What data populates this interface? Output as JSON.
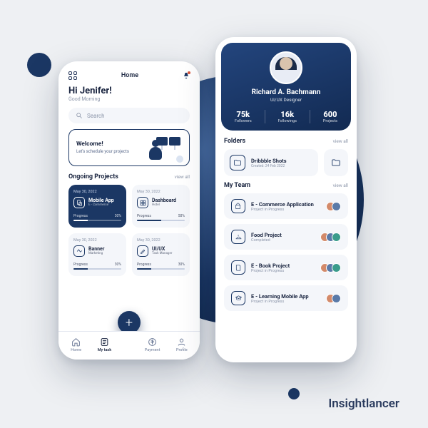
{
  "brand": "Insightlancer",
  "phone1": {
    "topbar_title": "Home",
    "greeting": "Hi Jenifer!",
    "sub_greeting": "Good Morning",
    "search_placeholder": "Search",
    "welcome": {
      "title": "Welcome!",
      "subtitle": "Let's schedule your projects"
    },
    "ongoing_header": "Ongoing Projects",
    "view_all": "view all",
    "projects": [
      {
        "date": "May 30, 2022",
        "name": "Mobile App",
        "category": "E - Commerce",
        "progress_label": "Progress",
        "percent": "30%",
        "pct": 30,
        "highlight": true
      },
      {
        "date": "May 30, 2022",
        "name": "Dashboard",
        "category": "Hotel",
        "progress_label": "Progress",
        "percent": "50%",
        "pct": 50,
        "highlight": false
      },
      {
        "date": "May 30, 2022",
        "name": "Banner",
        "category": "Marketing",
        "progress_label": "Progress",
        "percent": "30%",
        "pct": 30,
        "highlight": false
      },
      {
        "date": "May 30, 2022",
        "name": "UI/UX",
        "category": "Task Manager",
        "progress_label": "Progress",
        "percent": "30%",
        "pct": 30,
        "highlight": false
      }
    ],
    "nav": {
      "home": "Home",
      "mytask": "My task",
      "payment": "Payment",
      "profile": "Profile"
    }
  },
  "phone2": {
    "profile": {
      "name": "Richard A. Bachmann",
      "role": "UI/UX Designer",
      "stats": [
        {
          "value": "75k",
          "label": "Followers"
        },
        {
          "value": "16k",
          "label": "Followings"
        },
        {
          "value": "600",
          "label": "Projects"
        }
      ]
    },
    "folders_header": "Folders",
    "view_all": "view all",
    "folder": {
      "name": "Dribbble Shots",
      "date": "Created: 24 Feb 2022"
    },
    "team_header": "My Team",
    "team": [
      {
        "name": "E - Commerce Application",
        "status": "Project in Progress",
        "avatars": 2
      },
      {
        "name": "Food Project",
        "status": "Completed",
        "avatars": 3
      },
      {
        "name": "E - Book Project",
        "status": "Project in Progress",
        "avatars": 3
      },
      {
        "name": "E - Learning Mobile App",
        "status": "Project in Progress",
        "avatars": 2
      }
    ]
  }
}
